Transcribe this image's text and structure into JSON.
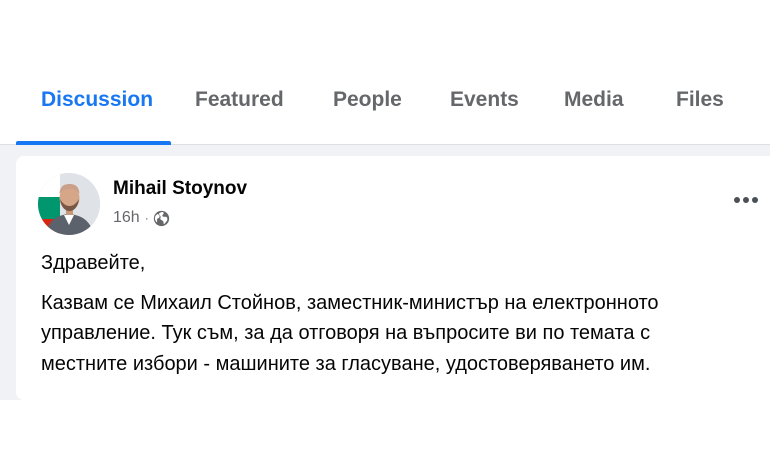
{
  "tabs": [
    {
      "label": "Discussion",
      "active": true
    },
    {
      "label": "Featured",
      "active": false
    },
    {
      "label": "People",
      "active": false
    },
    {
      "label": "Events",
      "active": false
    },
    {
      "label": "Media",
      "active": false
    },
    {
      "label": "Files",
      "active": false
    }
  ],
  "post": {
    "author": "Mihail Stoynov",
    "time": "16h",
    "separator": "·",
    "audience_icon": "globe-icon",
    "more_icon": "more-options-icon",
    "greeting": "Здравейте,",
    "body_lines": [
      "Казвам се Михаил Стойнов, заместник-министър на електронното",
      "управление. Тук съм, за да отговоря на въпросите ви по темата с",
      "местните избори - машините за гласуване, удостоверяването им."
    ]
  },
  "colors": {
    "accent": "#1877f2",
    "tab_inactive": "#65676b",
    "feed_background": "#f0f2f5",
    "text": "#050505",
    "flag_white": "#ffffff",
    "flag_green": "#00966e",
    "flag_red": "#d62612"
  }
}
